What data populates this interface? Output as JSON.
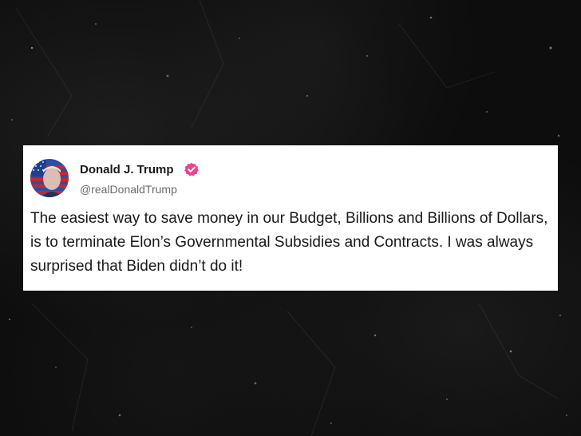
{
  "post": {
    "author_name": "Donald J. Trump",
    "handle": "@realDonaldTrump",
    "body": "The easiest way to save money in our Budget, Billions and Billions of Dollars, is to terminate Elon’s Governmental Subsidies and Contracts. I was always surprised that Biden didn’t do it!",
    "verified_icon": "verified-badge-icon",
    "verified_color": "#e8458b",
    "avatar_icon": "avatar-flag-portrait"
  },
  "colors": {
    "background": "#0d0d0d",
    "card": "#ffffff",
    "text": "#1a1a1a",
    "handle": "#6b6b6b"
  }
}
